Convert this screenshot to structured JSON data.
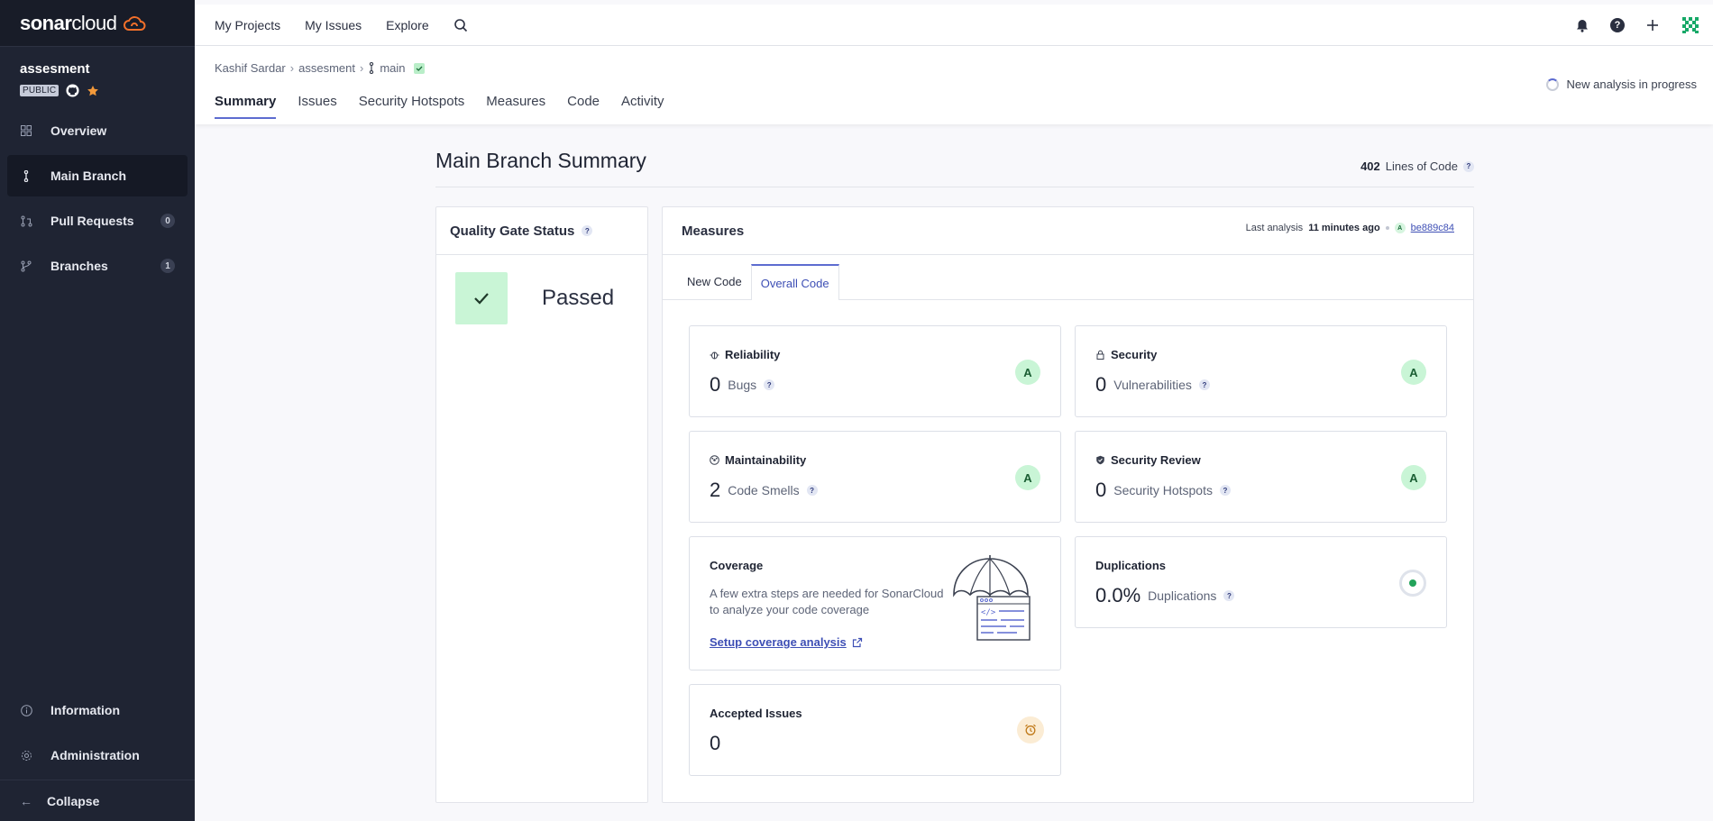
{
  "app": {
    "logo_bold": "sonar",
    "logo_light": "cloud"
  },
  "project": {
    "name": "assesment",
    "visibility": "PUBLIC"
  },
  "sidebar": {
    "items": [
      {
        "label": "Overview",
        "icon": "overview-icon"
      },
      {
        "label": "Main Branch",
        "icon": "branch-icon",
        "active": true
      },
      {
        "label": "Pull Requests",
        "icon": "pull-request-icon",
        "count": "0"
      },
      {
        "label": "Branches",
        "icon": "branches-icon",
        "count": "1"
      }
    ],
    "bottom": [
      {
        "label": "Information",
        "icon": "info-icon"
      },
      {
        "label": "Administration",
        "icon": "gear-icon"
      }
    ],
    "collapse_label": "Collapse"
  },
  "topbar": {
    "links": [
      "My Projects",
      "My Issues",
      "Explore"
    ],
    "help": "?"
  },
  "breadcrumb": {
    "org": "Kashif Sardar",
    "project": "assesment",
    "branch": "main"
  },
  "project_tabs": [
    "Summary",
    "Issues",
    "Security Hotspots",
    "Measures",
    "Code",
    "Activity"
  ],
  "analysis_status": "New analysis in progress",
  "summary": {
    "title": "Main Branch Summary",
    "loc_value": "402",
    "loc_label": "Lines of Code"
  },
  "quality_gate": {
    "title": "Quality Gate Status",
    "status": "Passed"
  },
  "measures": {
    "title": "Measures",
    "last_analysis_label": "Last analysis",
    "last_analysis_time": "11 minutes ago",
    "commit_grade": "A",
    "commit_hash": "be889c84",
    "tabs": [
      "New Code",
      "Overall Code"
    ],
    "reliability": {
      "title": "Reliability",
      "value": "0",
      "label": "Bugs",
      "grade": "A"
    },
    "security": {
      "title": "Security",
      "value": "0",
      "label": "Vulnerabilities",
      "grade": "A"
    },
    "maintainability": {
      "title": "Maintainability",
      "value": "2",
      "label": "Code Smells",
      "grade": "A"
    },
    "security_review": {
      "title": "Security Review",
      "value": "0",
      "label": "Security Hotspots",
      "grade": "A"
    },
    "coverage": {
      "title": "Coverage",
      "text": "A few extra steps are needed for SonarCloud to analyze your code coverage",
      "link": "Setup coverage analysis"
    },
    "duplications": {
      "title": "Duplications",
      "value": "0.0%",
      "label": "Duplications"
    },
    "accepted": {
      "title": "Accepted Issues",
      "value": "0"
    }
  },
  "colors": {
    "accent": "#5d6cd0",
    "sidebar": "#1f2433",
    "grade_a": "#c9f5d6",
    "passed": "#c9f5d6"
  }
}
